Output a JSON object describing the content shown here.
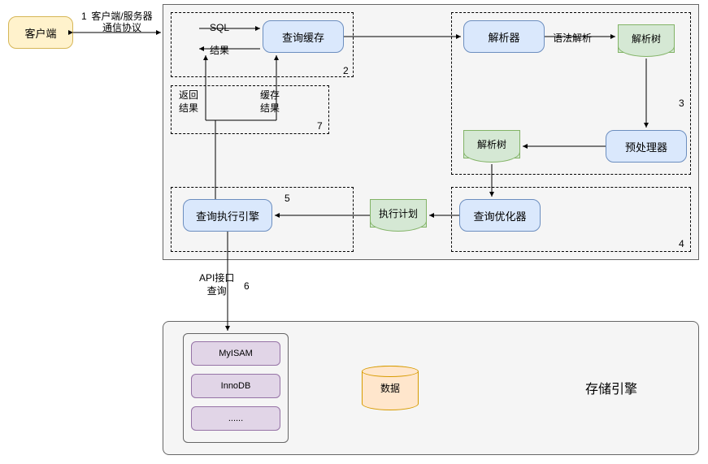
{
  "client": "客户端",
  "cache": "查询缓存",
  "parser": "解析器",
  "preprocessor": "预处理器",
  "optimizer": "查询优化器",
  "executor": "查询执行引擎",
  "parse_tree1": "解析树",
  "parse_tree2": "解析树",
  "exec_plan": "执行计划",
  "data": "数据",
  "storage_engine_title": "存储引擎",
  "engines": {
    "e1": "MyISAM",
    "e2": "InnoDB",
    "e3": "......"
  },
  "labels": {
    "protocol": "客户端/服务器通信协议",
    "sql": "SQL",
    "result": "结果",
    "return_result": "返回\n结果",
    "cache_result": "缓存\n结果",
    "syntax_parse": "语法解析",
    "api_query": "API接口\n查询"
  },
  "nums": {
    "n1": "1",
    "n2": "2",
    "n3": "3",
    "n4": "4",
    "n5": "5",
    "n6": "6",
    "n7": "7"
  }
}
